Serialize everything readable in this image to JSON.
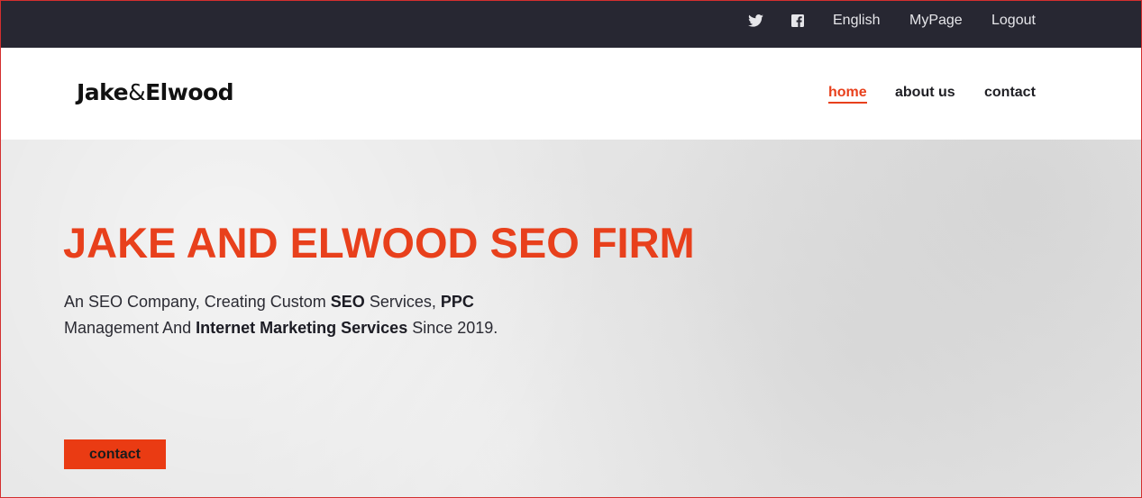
{
  "topbar": {
    "twitter_icon": "twitter-icon",
    "facebook_icon": "facebook-icon",
    "language": "English",
    "mypage": "MyPage",
    "logout": "Logout"
  },
  "header": {
    "logo_part1": "Jake",
    "logo_amp": "&",
    "logo_part2": "Elwood",
    "nav": {
      "home": "home",
      "about": "about us",
      "contact": "contact"
    }
  },
  "hero": {
    "title": "JAKE AND ELWOOD SEO FIRM",
    "text": {
      "t1": "An SEO Company, Creating Custom ",
      "b1": "SEO",
      "t2": " Services, ",
      "b2": "PPC",
      "t3": "Management And ",
      "b3": "Internet Marketing Services",
      "t4": " Since 2019."
    },
    "button": "contact"
  },
  "colors": {
    "accent": "#e8401c",
    "topbar_bg": "#272732",
    "text_dark": "#1f1f24"
  }
}
